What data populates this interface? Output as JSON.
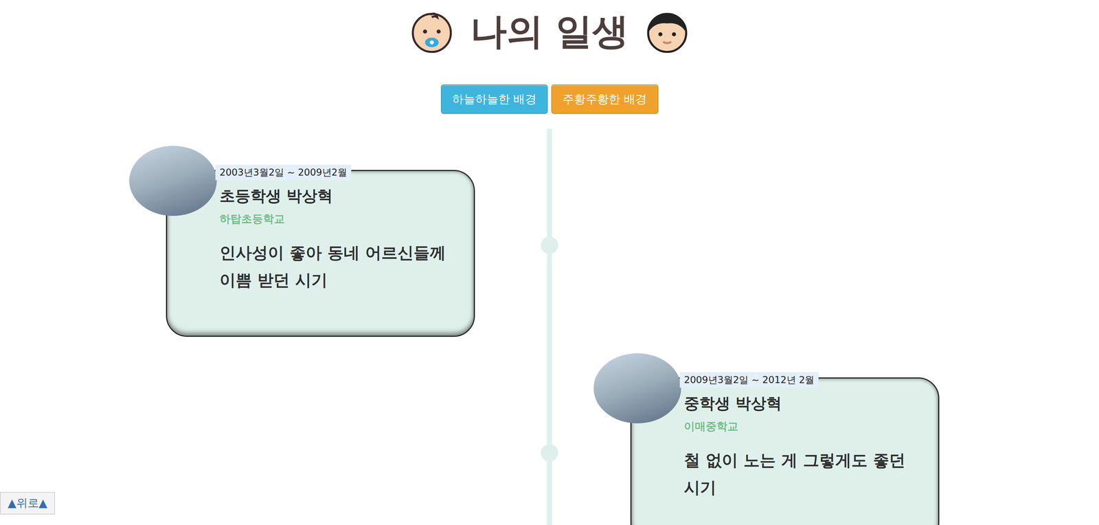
{
  "header": {
    "title": "나의 일생"
  },
  "buttons": [
    {
      "label": "하늘하늘한 배경",
      "color": "#3fb4dc"
    },
    {
      "label": "주황주황한 배경",
      "color": "#f0a12c"
    }
  ],
  "timeline": [
    {
      "date": "2003년3월2일 ~ 2009년2월",
      "title": "초등학생 박상혁",
      "school": "하탑초등학교",
      "description": "인사성이 좋아 동네 어르신들께 이쁨 받던 시기"
    },
    {
      "date": "2009년3월2일 ~ 2012년 2월",
      "title": "중학생 박상혁",
      "school": "이매중학교",
      "description": "철 없이 노는 게 그렇게도 좋던 시기"
    }
  ],
  "scroll_top": {
    "label": "▲위로▲"
  }
}
